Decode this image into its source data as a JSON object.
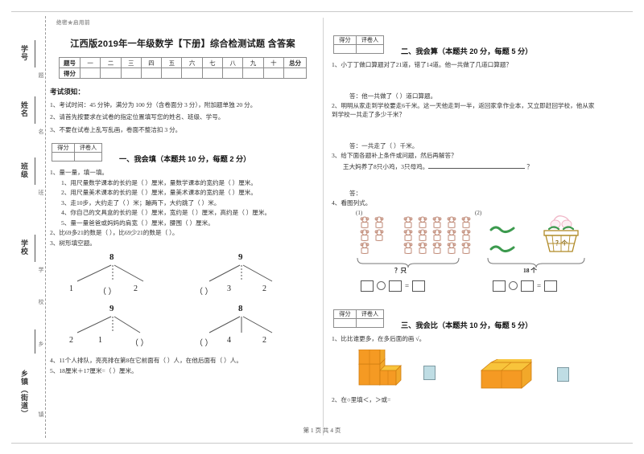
{
  "document": {
    "secret_mark": "绝密★启用前",
    "title": "江西版2019年一年级数学【下册】综合检测试题 含答案",
    "footer": "第 1 页 共 4 页"
  },
  "seal_column": {
    "labels": [
      "学号",
      "姓名",
      "班级",
      "学校",
      "乡镇（街道）"
    ],
    "notes": [
      "题",
      "名",
      "班",
      "学",
      "校",
      "乡",
      "镇"
    ]
  },
  "score_table": {
    "row_header_1": "题号",
    "row_header_2": "得分",
    "columns": [
      "一",
      "二",
      "三",
      "四",
      "五",
      "六",
      "七",
      "八",
      "九",
      "十"
    ],
    "total_label": "总分"
  },
  "notice": {
    "heading": "考试须知：",
    "rules": [
      "1、考试时间：45 分钟，满分为 100 分（含卷面分 3 分），附加题单独 20 分。",
      "2、请首先按要求在试卷的指定位置填写您的姓名、班级、学号。",
      "3、不要在试卷上乱写乱画，卷面不整洁扣 3 分。"
    ]
  },
  "grader_box": {
    "score_label": "得分",
    "grader_label": "评卷人"
  },
  "sections": [
    {
      "id": "section-1",
      "title": "一、我会填（本题共 10 分，每题 2 分）",
      "questions": [
        "1、量一量，填一填。",
        "1、用尺量数学课本的长约是（    ）厘米，量数学课本的宽约是（    ）厘米。",
        "2、用尺量美术课本的长约是（    ）厘米，量美术课本的宽约是（    ）厘米。",
        "3、走10步，大约走了（  ）米；蹦两下，大约跳了（    ）米。",
        "4、你自己的文具盒的长约是（    ）厘米，宽约是（    ）厘米，高约是（   ）厘米。",
        "5、量一量爸爸或妈妈的肩宽（    ）厘米，腰围（    ）厘米。",
        "2、比69多21的数是（        ），比69少21的数是（     ）。",
        "3、树形填空题。",
        "4、11个人排队，亮亮排在第8在它前面有（    ）人，在他后面有（    ）人。",
        "5、18厘米＋17厘米=（         ）厘米。"
      ],
      "trees": [
        {
          "top": "8",
          "leaves": [
            "1",
            "（  ）",
            "2"
          ]
        },
        {
          "top": "9",
          "leaves": [
            "（  ）",
            "3",
            "2"
          ]
        },
        {
          "top": "9",
          "leaves": [
            "2",
            "1",
            "（  ）"
          ]
        },
        {
          "top": "8",
          "leaves": [
            "（  ）",
            "4",
            "2"
          ]
        }
      ]
    },
    {
      "id": "section-2",
      "title": "二、我会算（本题共 20 分，每题 5 分）",
      "questions": [
        "1、小丁丁做口算题对了21道，错了14道。他一共做了几道口算题？",
        "答：他一共做了（    ）道口算题。",
        "2、明明从家走到学校要走6千米。这一天他走到一半，返回家拿作业本，又立即赶回学校，他从家到学校一共走了多少千米？",
        "答：一共走了（   ）千米。",
        "3、给下面各题补上条件或问题，然后再解答？",
        "王大妈养了8只小鸡，3只母鸡。",
        "答：",
        "4、看图列式。"
      ],
      "picture_question": {
        "sub1": {
          "label": "(1)",
          "brace_label": "？只",
          "equation": [
            "□",
            "○",
            "□",
            "=",
            "□"
          ]
        },
        "sub2": {
          "label": "(2)",
          "brace_label": "18 个",
          "basket_label": "？个",
          "equation": [
            "□",
            "○",
            "□",
            "=",
            "□"
          ]
        }
      }
    },
    {
      "id": "section-3",
      "title": "三、我会比（本题共 10 分，每题 5 分）",
      "questions": [
        "1、比比谁更多，在多后面的画 √。",
        "2、在○里填＜，＞或="
      ]
    }
  ],
  "colors": {
    "block_orange": "#f59a23",
    "block_top": "#f8c43b",
    "checkbox_blue": "#bfdde4",
    "monkey": "#c08b78",
    "veg_green": "#3c9a4e",
    "basket": "#b08a26"
  }
}
